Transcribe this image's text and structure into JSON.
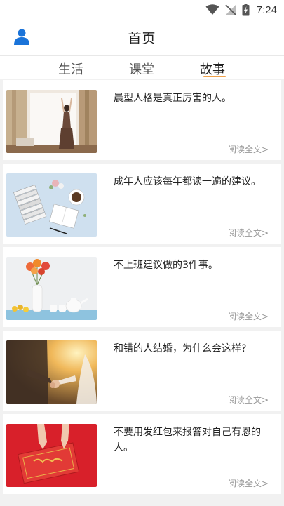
{
  "status": {
    "time": "7:24",
    "icons": [
      "wifi-icon",
      "signal-off-icon",
      "battery-charging-icon"
    ]
  },
  "header": {
    "title": "首页",
    "avatar_icon": "user-icon"
  },
  "tabs": [
    {
      "label": "生活",
      "active": false
    },
    {
      "label": "课堂",
      "active": false
    },
    {
      "label": "故事",
      "active": true
    }
  ],
  "accent_color": "#f0a24b",
  "brand_color": "#1a73d9",
  "articles": [
    {
      "title": "晨型人格是真正厉害的人。",
      "read_more": "阅读全文>",
      "image": "woman-by-window"
    },
    {
      "title": "成年人应该每年都读一遍的建议。",
      "read_more": "阅读全文>",
      "image": "books-and-coffee"
    },
    {
      "title": "不上班建议做的3件事。",
      "read_more": "阅读全文>",
      "image": "flowers-and-teapot"
    },
    {
      "title": "和错的人结婚，为什么会这样?",
      "read_more": "阅读全文>",
      "image": "couple-holding-hands"
    },
    {
      "title": "不要用发红包来报答对自己有恩的人。",
      "read_more": "阅读全文>",
      "image": "red-envelopes"
    }
  ]
}
